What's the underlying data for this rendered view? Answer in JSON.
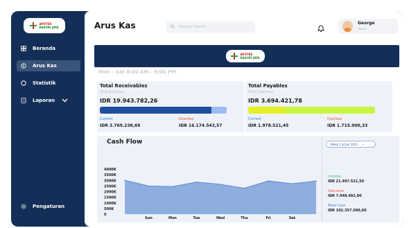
{
  "brand": {
    "line1": "APOTEK",
    "line2": "RASURI JAYA",
    "color_red": "#c72020",
    "color_green": "#1c8a34"
  },
  "sidebar": {
    "bg_color": "#132f57",
    "items": [
      {
        "label": "Beranda",
        "icon": "grid-icon"
      },
      {
        "label": "Arus Kas",
        "icon": "money-icon",
        "active": true
      },
      {
        "label": "Statistik",
        "icon": "circle-icon"
      },
      {
        "label": "Laporan",
        "icon": "document-icon",
        "has_dropdown": true
      }
    ],
    "bottom_item": {
      "label": "Pengaturan",
      "icon": "gear-icon"
    }
  },
  "header": {
    "title": "Arus Kas",
    "search_placeholder": "General Search...",
    "user_name": "George",
    "user_role": "Owner"
  },
  "hours": "Mon - Sat 8:00 AM - 8:00 PM",
  "receivables": {
    "title": "Total Receivables",
    "subtitle": "Total Earnings",
    "amount": "IDR 19.943.782,26",
    "bar_fraction": 0.88,
    "bar_fill_color": "#1f4e9c",
    "bar_track_color": "#9bbcf1",
    "current_label": "Current",
    "current_value": "IDR 3.769.238,69",
    "overdue_label": "Overdue",
    "overdue_value": "IDR 16.174.543,57"
  },
  "payables": {
    "title": "Total Payables",
    "subtitle": "Total Expenses",
    "amount": "IDR 3.694.421,78",
    "bar_fraction": 0.29,
    "bar_fill_color": "#e4ef24",
    "bar_track_color": "#c8f542",
    "current_label": "Current",
    "current_value": "IDR 1.978.521,45",
    "overdue_label": "Overdue",
    "overdue_value": "IDR 1.715.900,33"
  },
  "colors": {
    "current": "#2d7bd8",
    "overdue": "#e8502d",
    "income": "#33c05a",
    "outcome": "#e64545",
    "total_cash": "#3d7bd6"
  },
  "cashflow": {
    "title": "Cash Flow",
    "week_selector": "Week 1 of Jan 2023",
    "income_label": "Income",
    "income_value": "IDR 21.497.521,50",
    "outcome_label": "Outcome",
    "outcome_value": "IDR 7.948.492,80",
    "total_label": "Total Cash",
    "total_value": "IDR 102.357.500,60"
  },
  "chart_data": {
    "type": "area",
    "title": "Cash Flow",
    "categories": [
      "",
      "Sun",
      "Mon",
      "Tue",
      "Wed",
      "Thu",
      "Fri",
      "Sat",
      ""
    ],
    "values": [
      3000,
      2500,
      2450,
      2850,
      2650,
      2300,
      2950,
      2700,
      2950
    ],
    "y_ticks": [
      "4000K",
      "3500K",
      "3000K",
      "2500K",
      "2000K",
      "1500K",
      "1000K",
      "500K",
      "0"
    ],
    "ylim": [
      0,
      4000
    ],
    "fill_color": "#8eaee0",
    "line_color": "#5b86cf"
  }
}
